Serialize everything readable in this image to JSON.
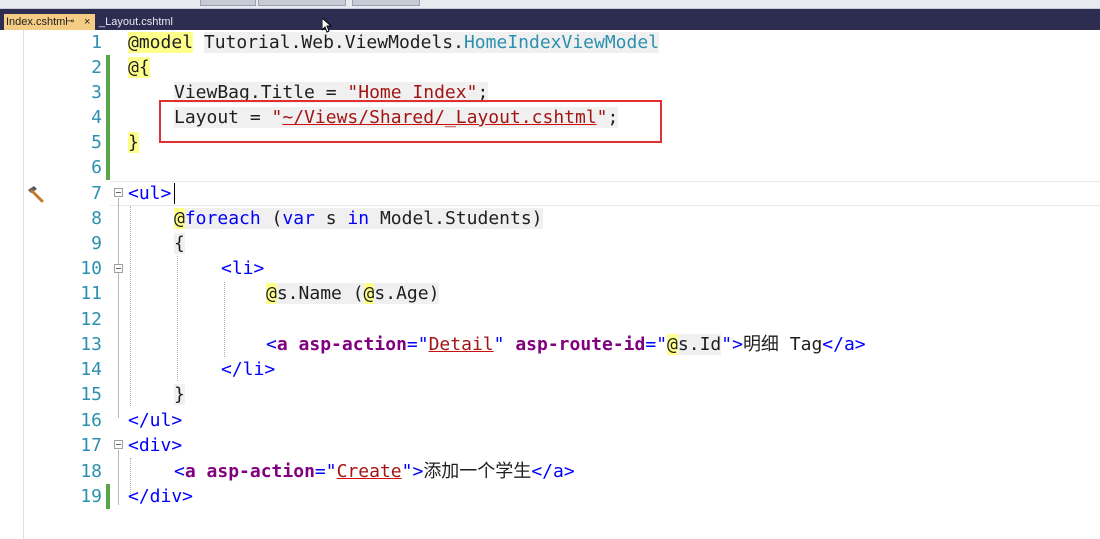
{
  "tabs": [
    {
      "label": "Index.cshtml",
      "active": true,
      "pin_glyph": "⊸",
      "close_glyph": "×"
    },
    {
      "label": "_Layout.cshtml",
      "active": false
    }
  ],
  "editor": {
    "lines": [
      {
        "n": "1"
      },
      {
        "n": "2"
      },
      {
        "n": "3"
      },
      {
        "n": "4"
      },
      {
        "n": "5"
      },
      {
        "n": "6"
      },
      {
        "n": "7"
      },
      {
        "n": "8"
      },
      {
        "n": "9"
      },
      {
        "n": "10"
      },
      {
        "n": "11"
      },
      {
        "n": "12"
      },
      {
        "n": "13"
      },
      {
        "n": "14"
      },
      {
        "n": "15"
      },
      {
        "n": "16"
      },
      {
        "n": "17"
      },
      {
        "n": "18"
      },
      {
        "n": "19"
      }
    ],
    "tok": {
      "at": "@",
      "model": "model",
      "model_ns": "Tutorial.Web.ViewModels.",
      "model_type": "HomeIndexViewModel",
      "brace_open": "{",
      "brace_close": "}",
      "viewbag": "ViewBag.Title = ",
      "title_str": "\"Home Index\"",
      "semi": ";",
      "layout": "Layout = ",
      "q": "\"",
      "layout_path": "~/Views/Shared/_Layout.cshtml",
      "ul_open": "<ul>",
      "ul_close": "</ul>",
      "foreach": "foreach",
      "foreach_open": " (",
      "var": "var",
      "s_sp": " s ",
      "in": "in",
      "model_students": " Model.Students)",
      "li_open": "<li>",
      "li_close": "</li>",
      "s_name": "s.Name (",
      "s_age": "s.Age)",
      "a_lt": "<",
      "a_name": "a",
      "a_gt": ">",
      "a_close": "</a>",
      "asp_action": "asp-action",
      "eq": "=",
      "detail": "Detail",
      "asp_route_id": "asp-route-id",
      "s_id": "s.Id",
      "detail_text": "明细 Tag",
      "create": "Create",
      "create_text": "添加一个学生",
      "div_open": "<div>",
      "div_close": "</div>",
      "sp": " "
    }
  }
}
